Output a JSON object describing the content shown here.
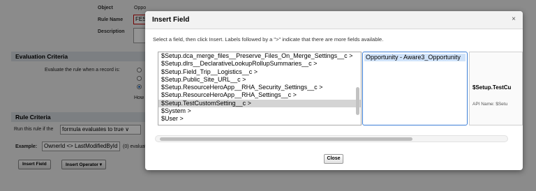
{
  "background_page": {
    "object_label": "Object",
    "object_value": "Oppo",
    "rule_name_label": "Rule Name",
    "rule_name_value": "FES",
    "description_label": "Description",
    "evaluation_section": "Evaluation Criteria",
    "evaluate_label": "Evaluate the rule when a record is:",
    "radio_options": [
      "c",
      "c",
      "c"
    ],
    "how_text": "How",
    "rule_criteria_section": "Rule Criteria",
    "run_rule_label": "Run this rule if the",
    "criteria_select_value": "formula evaluates to true ∨",
    "example_label": "Example:",
    "example_value": "OwnerId <> LastModifiedById",
    "example_note": "(0) evaluat",
    "insert_field_button": "Insert Field",
    "insert_operator_button": "Insert Operator ▾"
  },
  "modal": {
    "title": "Insert Field",
    "close_icon": "×",
    "instructions": "Select a field, then click Insert. Labels followed by a \">\" indicate that there are more fields available.",
    "field_list": [
      "$Setup.dca_merge_files__Preserve_Files_On_Merge_Settings__c >",
      "$Setup.dlrs__DeclarativeLookupRollupSummaries__c >",
      "$Setup.Field_Trip__Logistics__c >",
      "$Setup.Public_Site_URL__c >",
      "$Setup.ResourceHeroApp__RHA_Security_Settings__c >",
      "$Setup.ResourceHeroApp__RHA_Settings__c >",
      "$Setup.TestCustomSetting__c >",
      "$System >",
      "$User >"
    ],
    "selected_field_index": 6,
    "sub_list": [
      "Opportunity - Aware3_Opportunity"
    ],
    "detail_title": "$Setup.TestCu",
    "detail_api": "API Name: $Setu",
    "close_button": "Close"
  }
}
